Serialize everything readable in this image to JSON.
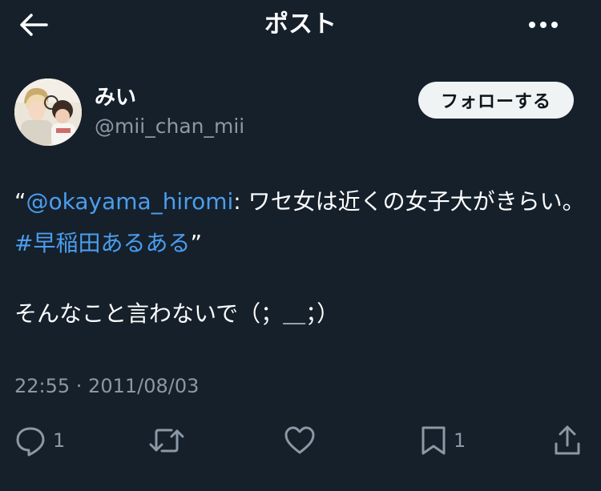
{
  "header": {
    "title": "ポスト"
  },
  "post": {
    "author": {
      "display_name": "みい",
      "handle": "@mii_chan_mii"
    },
    "follow_label": "フォローする",
    "text": {
      "open_quote": "“",
      "mention": "@okayama_hiromi",
      "body": ": ワセ女は近くの女子大がきらい。　",
      "hashtag": "#早稲田あるある",
      "close_quote": "”",
      "reply": "そんなこと言わないで（；＿；）"
    },
    "timestamp": "22:55 · 2011/08/03"
  },
  "actions": {
    "reply_count": "1",
    "bookmark_count": "1"
  },
  "colors": {
    "background": "#15202b",
    "link": "#4c9ded",
    "secondary_text": "#8b98a5",
    "follow_button_bg": "#eff3f4"
  },
  "icons": [
    "back-arrow-icon",
    "more-icon",
    "reply-icon",
    "repost-icon",
    "like-icon",
    "bookmark-icon",
    "share-icon"
  ]
}
